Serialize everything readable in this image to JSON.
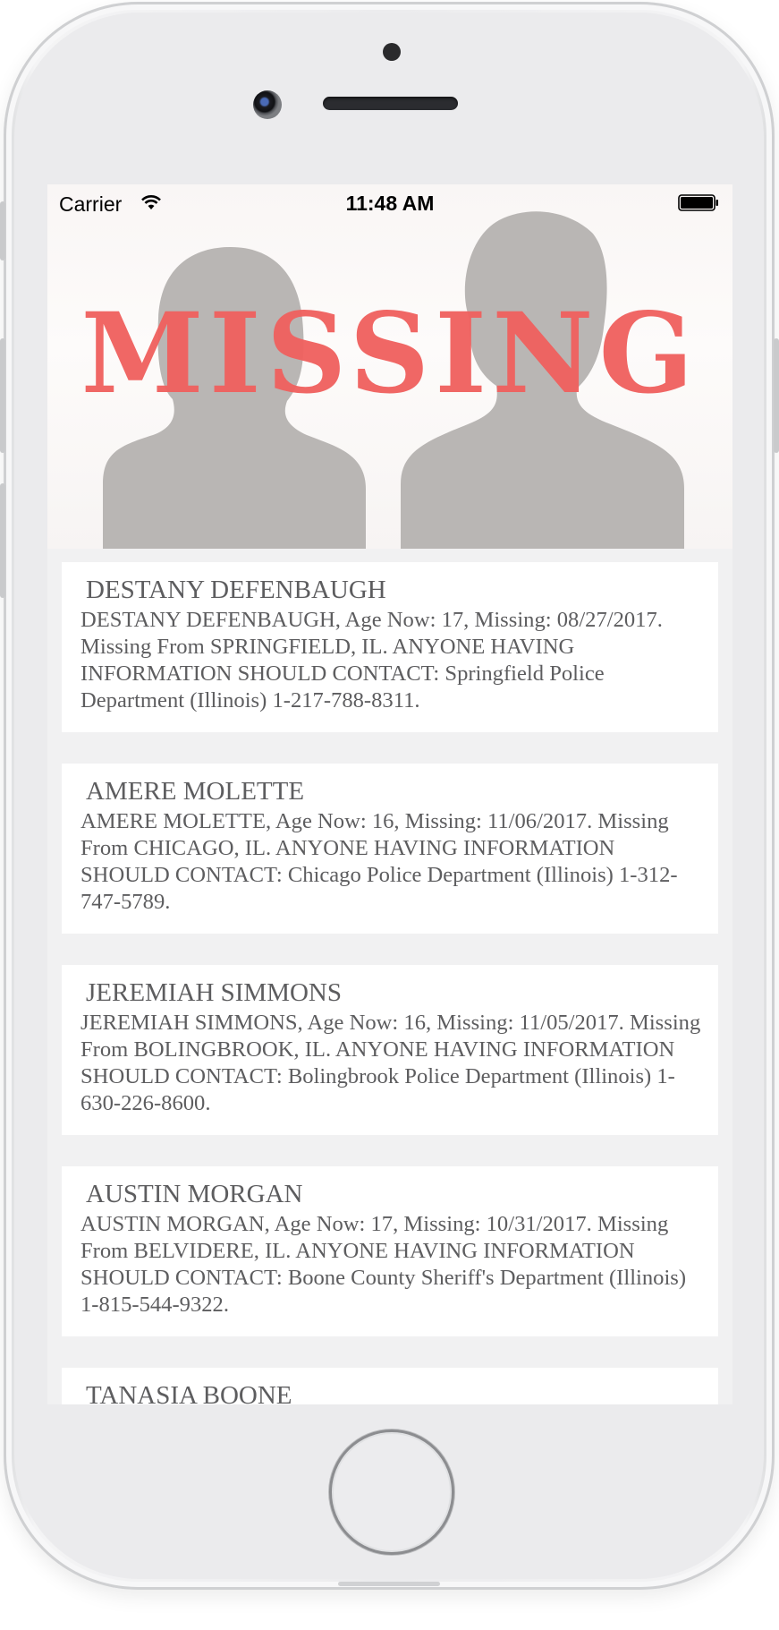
{
  "status_bar": {
    "carrier": "Carrier",
    "time": "11:48 AM",
    "wifi_icon": "wifi-icon",
    "battery_icon": "battery-icon"
  },
  "hero": {
    "title": "MISSING",
    "title_color": "#f0605e",
    "silhouette_color": "#b9b6b4"
  },
  "missing_list": [
    {
      "name": "DESTANY DEFENBAUGH",
      "details": "DESTANY DEFENBAUGH, Age Now: 17, Missing: 08/27/2017. Missing From SPRINGFIELD, IL. ANYONE HAVING INFORMATION SHOULD CONTACT: Springfield Police Department (Illinois) 1-217-788-8311."
    },
    {
      "name": "AMERE MOLETTE",
      "details": "AMERE MOLETTE, Age Now: 16, Missing: 11/06/2017. Missing From CHICAGO, IL. ANYONE HAVING INFORMATION SHOULD CONTACT: Chicago Police Department (Illinois) 1-312-747-5789."
    },
    {
      "name": "JEREMIAH SIMMONS",
      "details": "JEREMIAH SIMMONS, Age Now: 16, Missing: 11/05/2017. Missing From BOLINGBROOK, IL. ANYONE HAVING INFORMATION SHOULD CONTACT: Bolingbrook Police Department (Illinois) 1-630-226-8600."
    },
    {
      "name": "AUSTIN MORGAN",
      "details": "AUSTIN MORGAN, Age Now: 17, Missing: 10/31/2017. Missing From BELVIDERE, IL. ANYONE HAVING INFORMATION SHOULD CONTACT: Boone County Sheriff's Department  (Illinois)  1-815-544-9322."
    },
    {
      "name": "TANASIA BOONE",
      "details": ""
    }
  ],
  "device": {
    "home_button": "home-button"
  }
}
